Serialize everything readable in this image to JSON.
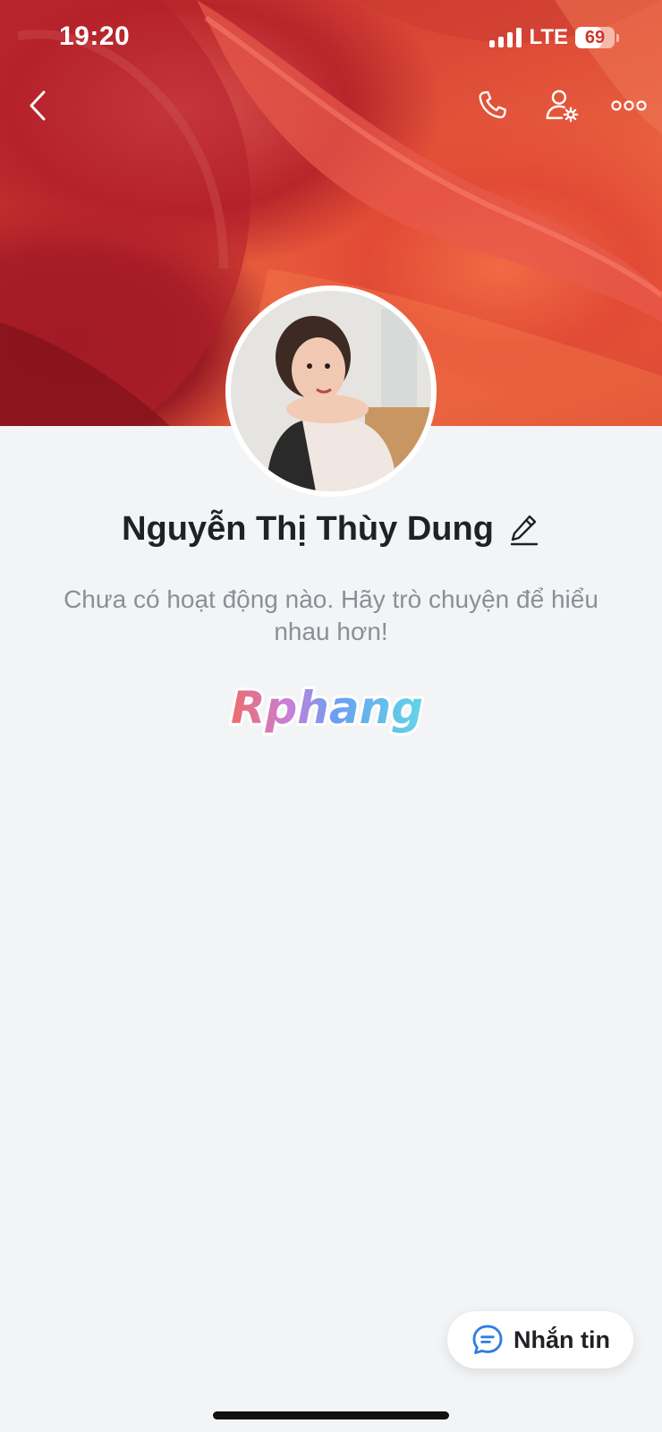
{
  "status_bar": {
    "time": "19:20",
    "network": "LTE",
    "battery_level": "69",
    "battery_fraction": 0.69
  },
  "header": {
    "back_icon": "chevron-left-icon",
    "call_icon": "phone-icon",
    "settings_icon": "user-settings-icon",
    "more_icon": "more-horizontal-icon"
  },
  "profile": {
    "name": "Nguyễn Thị Thùy Dung",
    "edit_icon": "pencil-icon",
    "activity_text": "Chưa có hoạt động nào. Hãy trò chuyện để hiểu nhau hơn!"
  },
  "watermark": {
    "text": "Rphang"
  },
  "actions": {
    "message_label": "Nhắn tin",
    "message_icon": "chat-bubble-icon",
    "accent": "#2f7de1"
  }
}
